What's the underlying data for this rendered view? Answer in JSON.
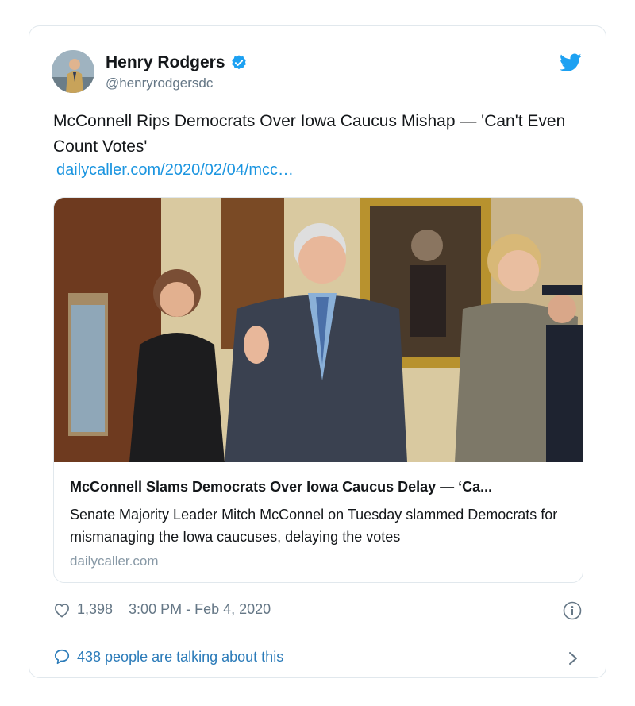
{
  "tweet": {
    "author_name": "Henry Rodgers",
    "author_handle": "@henryrodgersdc",
    "verified_icon": "verified-badge-icon",
    "brand_icon": "twitter-bird-icon",
    "text": "McConnell Rips Democrats Over Iowa Caucus Mishap — 'Can't Even Count Votes'",
    "link": "dailycaller.com/2020/02/04/mcc…"
  },
  "card": {
    "title": "McConnell Slams Democrats Over Iowa Caucus Delay — ‘Ca...",
    "description": "Senate Majority Leader Mitch McConnel on Tuesday slammed Democrats for mismanaging the Iowa caucuses, delaying the votes",
    "domain": "dailycaller.com"
  },
  "footer": {
    "likes": "1,398",
    "timestamp": "3:00 PM - Feb 4, 2020",
    "talking": "438 people are talking about this"
  },
  "colors": {
    "accent": "#1da1f2",
    "link": "#1b95e0",
    "muted": "#657786",
    "border": "#e1e8ed"
  }
}
